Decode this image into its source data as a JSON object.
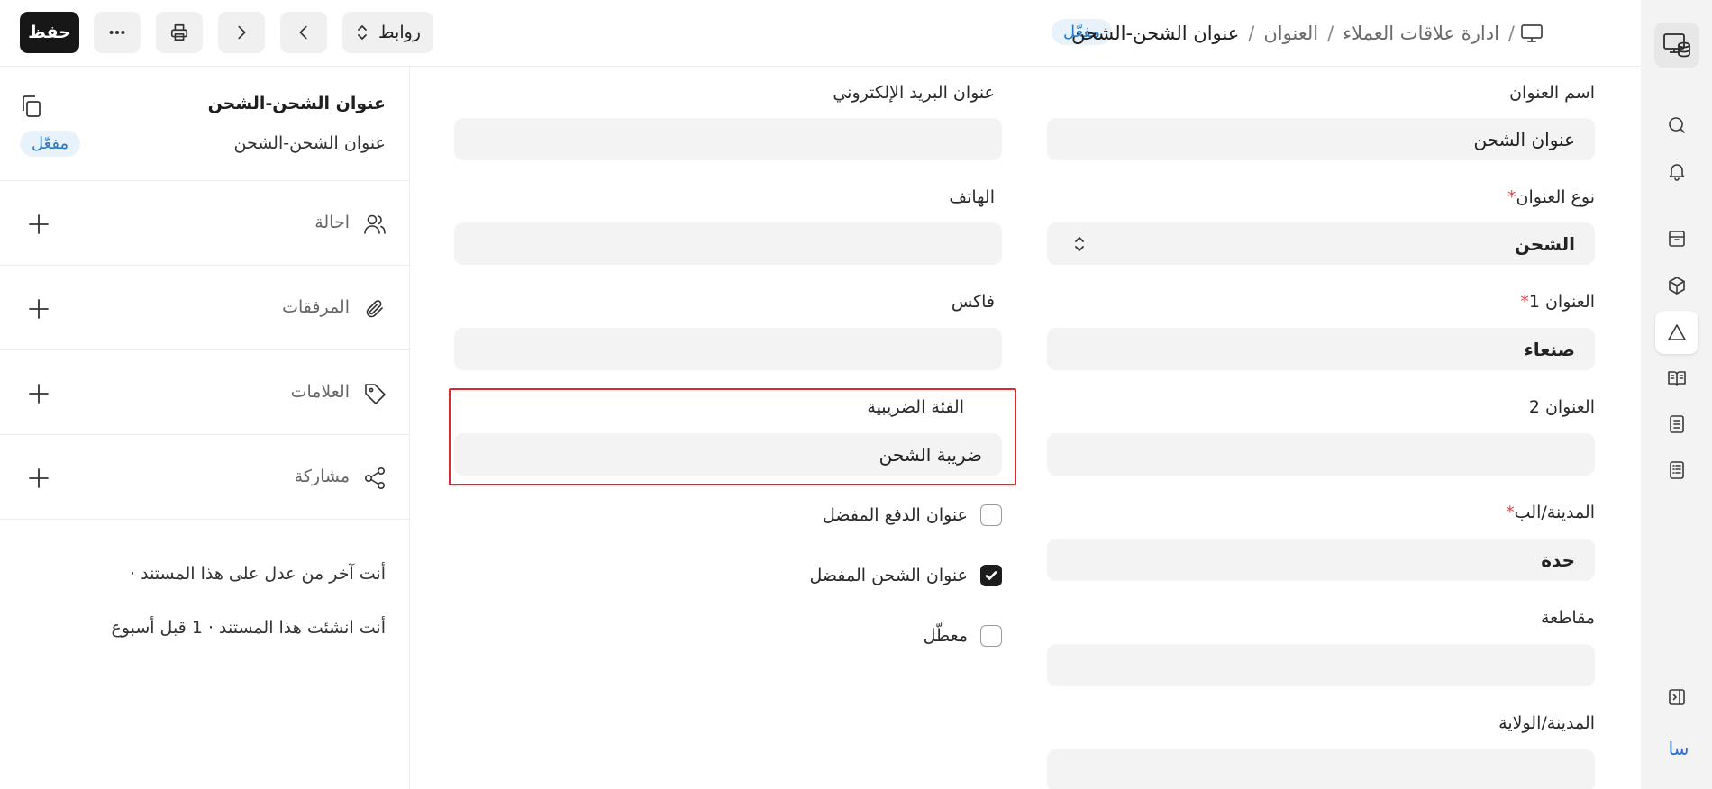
{
  "header": {
    "breadcrumbs": [
      "ادارة علاقات العملاء",
      "العنوان",
      "عنوان الشحن-الشحن"
    ],
    "status": "مفعّل",
    "save_label": "حفظ",
    "links_label": "روابط"
  },
  "sidebar": {
    "title": "عنوان الشحن-الشحن",
    "subtitle": "عنوان الشحن-الشحن",
    "status": "مفعّل",
    "items": [
      {
        "label": "احالة",
        "icon": "users-icon"
      },
      {
        "label": "المرفقات",
        "icon": "paperclip-icon"
      },
      {
        "label": "العلامات",
        "icon": "tag-icon"
      },
      {
        "label": "مشاركة",
        "icon": "share-icon"
      }
    ],
    "activity": [
      "أنت آخر من عدل على هذا المستند · ",
      "أنت انشئت هذا المستند · 1 قبل أسبوع"
    ]
  },
  "form": {
    "address_title": {
      "label": "اسم العنوان",
      "value": "عنوان الشحن"
    },
    "address_type": {
      "label": "نوع العنوان",
      "required_mark": "*",
      "value": "الشحن"
    },
    "address_line1": {
      "label": "العنوان 1",
      "required_mark": "*",
      "value": "صنعاء"
    },
    "address_line2": {
      "label": "العنوان 2",
      "value": ""
    },
    "city": {
      "label": "المدينة/الب",
      "required_mark": "*",
      "value": "حدة"
    },
    "county": {
      "label": "مقاطعة",
      "value": ""
    },
    "state": {
      "label": "المدينة/الولاية",
      "value": ""
    },
    "email": {
      "label": "عنوان البريد الإلكتروني",
      "value": ""
    },
    "phone": {
      "label": "الهاتف",
      "value": ""
    },
    "fax": {
      "label": "فاكس",
      "value": ""
    },
    "tax_category": {
      "label": "الفئة الضريبية",
      "value": "ضريبة الشحن"
    },
    "is_primary_address": {
      "label": "عنوان الدفع المفضل",
      "checked": false
    },
    "is_shipping_address": {
      "label": "عنوان الشحن المفضل",
      "checked": true
    },
    "disabled": {
      "label": "معطّل",
      "checked": false
    }
  },
  "rail": {
    "avatar_initials": "سا",
    "icons": [
      "app-logo-icon",
      "search-icon",
      "bell-icon",
      "archive-icon",
      "box-icon",
      "triangle-icon",
      "book-open-icon",
      "notebook-icon",
      "list-icon",
      "sidebar-toggle-icon"
    ]
  },
  "colors": {
    "accent_pill_bg": "#e8f2fb",
    "accent_pill_text": "#2b78c2",
    "primary_button": "#171717",
    "highlight_border": "#e0282e",
    "required_mark": "#e0474b"
  }
}
